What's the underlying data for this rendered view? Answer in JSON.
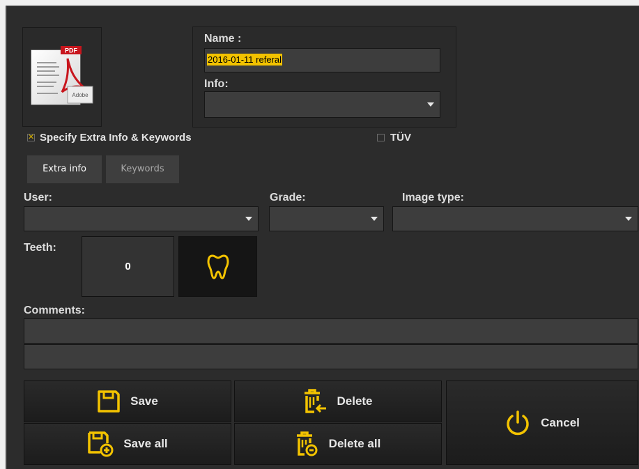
{
  "thumbnail": {
    "badge": "PDF",
    "brand": "Adobe",
    "icon": "pdf-document-icon"
  },
  "name": {
    "label": "Name :",
    "value": "2016-01-11  referal"
  },
  "info": {
    "label": "Info:",
    "value": ""
  },
  "extra_checkbox": {
    "label": "Specify Extra Info & Keywords",
    "checked": true
  },
  "tuv_checkbox": {
    "label": "TÜV",
    "checked": false
  },
  "tabs": [
    {
      "label": "Extra info",
      "active": true
    },
    {
      "label": "Keywords",
      "active": false
    }
  ],
  "user": {
    "label": "User:",
    "value": ""
  },
  "grade": {
    "label": "Grade:",
    "value": ""
  },
  "image_type": {
    "label": "Image type:",
    "value": ""
  },
  "teeth": {
    "label": "Teeth:",
    "count": "0",
    "icon": "tooth-icon"
  },
  "comments": {
    "label": "Comments:",
    "line1": "",
    "line2": ""
  },
  "buttons": {
    "save": "Save",
    "save_all": "Save all",
    "delete": "Delete",
    "delete_all": "Delete all",
    "cancel": "Cancel"
  },
  "colors": {
    "accent": "#f3c300",
    "background": "#2c2c2c",
    "field": "#3d3d3d"
  }
}
